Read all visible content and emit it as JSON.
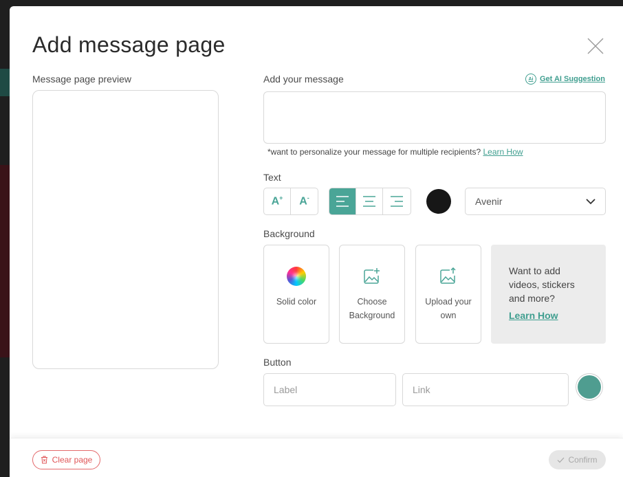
{
  "modal": {
    "title": "Add message page",
    "close_icon": "close-icon"
  },
  "preview": {
    "label": "Message page preview"
  },
  "message": {
    "label": "Add your message",
    "value": "",
    "ai_suggestion": "Get AI Suggestion",
    "ai_icon_text": "Ai",
    "note": "*want to personalize your message for multiple recipients?",
    "note_link": "Learn How"
  },
  "text": {
    "label": "Text",
    "increase_icon": "font-size-increase-icon",
    "decrease_icon": "font-size-decrease-icon",
    "alignments": [
      "align-left-icon",
      "align-center-icon",
      "align-right-icon"
    ],
    "active_alignment": "align-left",
    "color": "#171717",
    "font": "Avenir"
  },
  "background": {
    "label": "Background",
    "options": [
      {
        "label": "Solid color",
        "icon": "color-wheel-icon"
      },
      {
        "label": "Choose Background",
        "icon": "image-add-icon"
      },
      {
        "label": "Upload your own",
        "icon": "image-upload-icon"
      }
    ],
    "promo_text": "Want to add videos, stickers and more?",
    "promo_link": "Learn How"
  },
  "button": {
    "label": "Button",
    "label_placeholder": "Label",
    "link_placeholder": "Link",
    "color": "#4f9d90"
  },
  "footer": {
    "clear_label": "Clear page",
    "confirm_label": "Confirm"
  },
  "colors": {
    "accent": "#4aa597",
    "danger": "#e05557"
  }
}
